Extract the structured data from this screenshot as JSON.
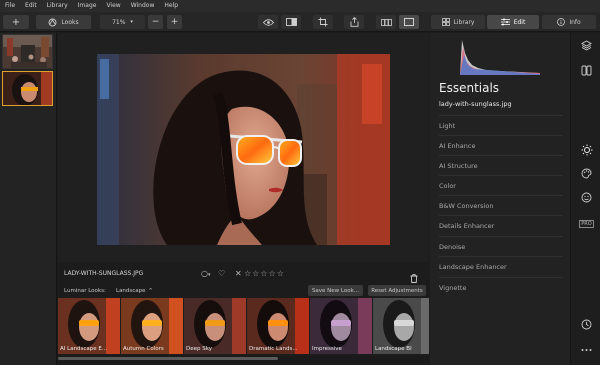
{
  "menubar": {
    "items": [
      "File",
      "Edit",
      "Library",
      "Image",
      "View",
      "Window",
      "Help"
    ]
  },
  "toolbar": {
    "add_label": "+",
    "looks_label": "Looks",
    "zoom_value": "71%",
    "zoom_out": "−",
    "zoom_in": "+"
  },
  "tabs": [
    {
      "label": "Library",
      "icon": "library-icon"
    },
    {
      "label": "Edit",
      "icon": "sliders-icon"
    },
    {
      "label": "Info",
      "icon": "info-icon"
    }
  ],
  "image": {
    "filename": "LADY-WITH-SUNGLASS.JPG",
    "rating_stars": 5
  },
  "luminar_looks": {
    "label": "Luminar Looks:",
    "category": "Landscape",
    "save_button": "Save New Look...",
    "reset_button": "Reset Adjustments",
    "items": [
      "AI Landscape E...",
      "Autumn Colors",
      "Deep Sky",
      "Dramatic Lands...",
      "Impressive",
      "Landscape Bl"
    ]
  },
  "essentials": {
    "title": "Essentials",
    "file": "lady-with-sunglass.jpg",
    "tools": [
      "Light",
      "AI Enhance",
      "AI Structure",
      "Color",
      "B&W Conversion",
      "Details Enhancer",
      "Denoise",
      "Landscape Enhancer",
      "Vignette"
    ]
  },
  "side_icons": [
    "layers-icon",
    "canvas-icon",
    "sun-icon",
    "palette-icon",
    "face-icon",
    "pro-icon",
    "history-icon",
    "more-icon"
  ],
  "pro_label": "PRO",
  "colors": {
    "accent": "#e0a030"
  }
}
